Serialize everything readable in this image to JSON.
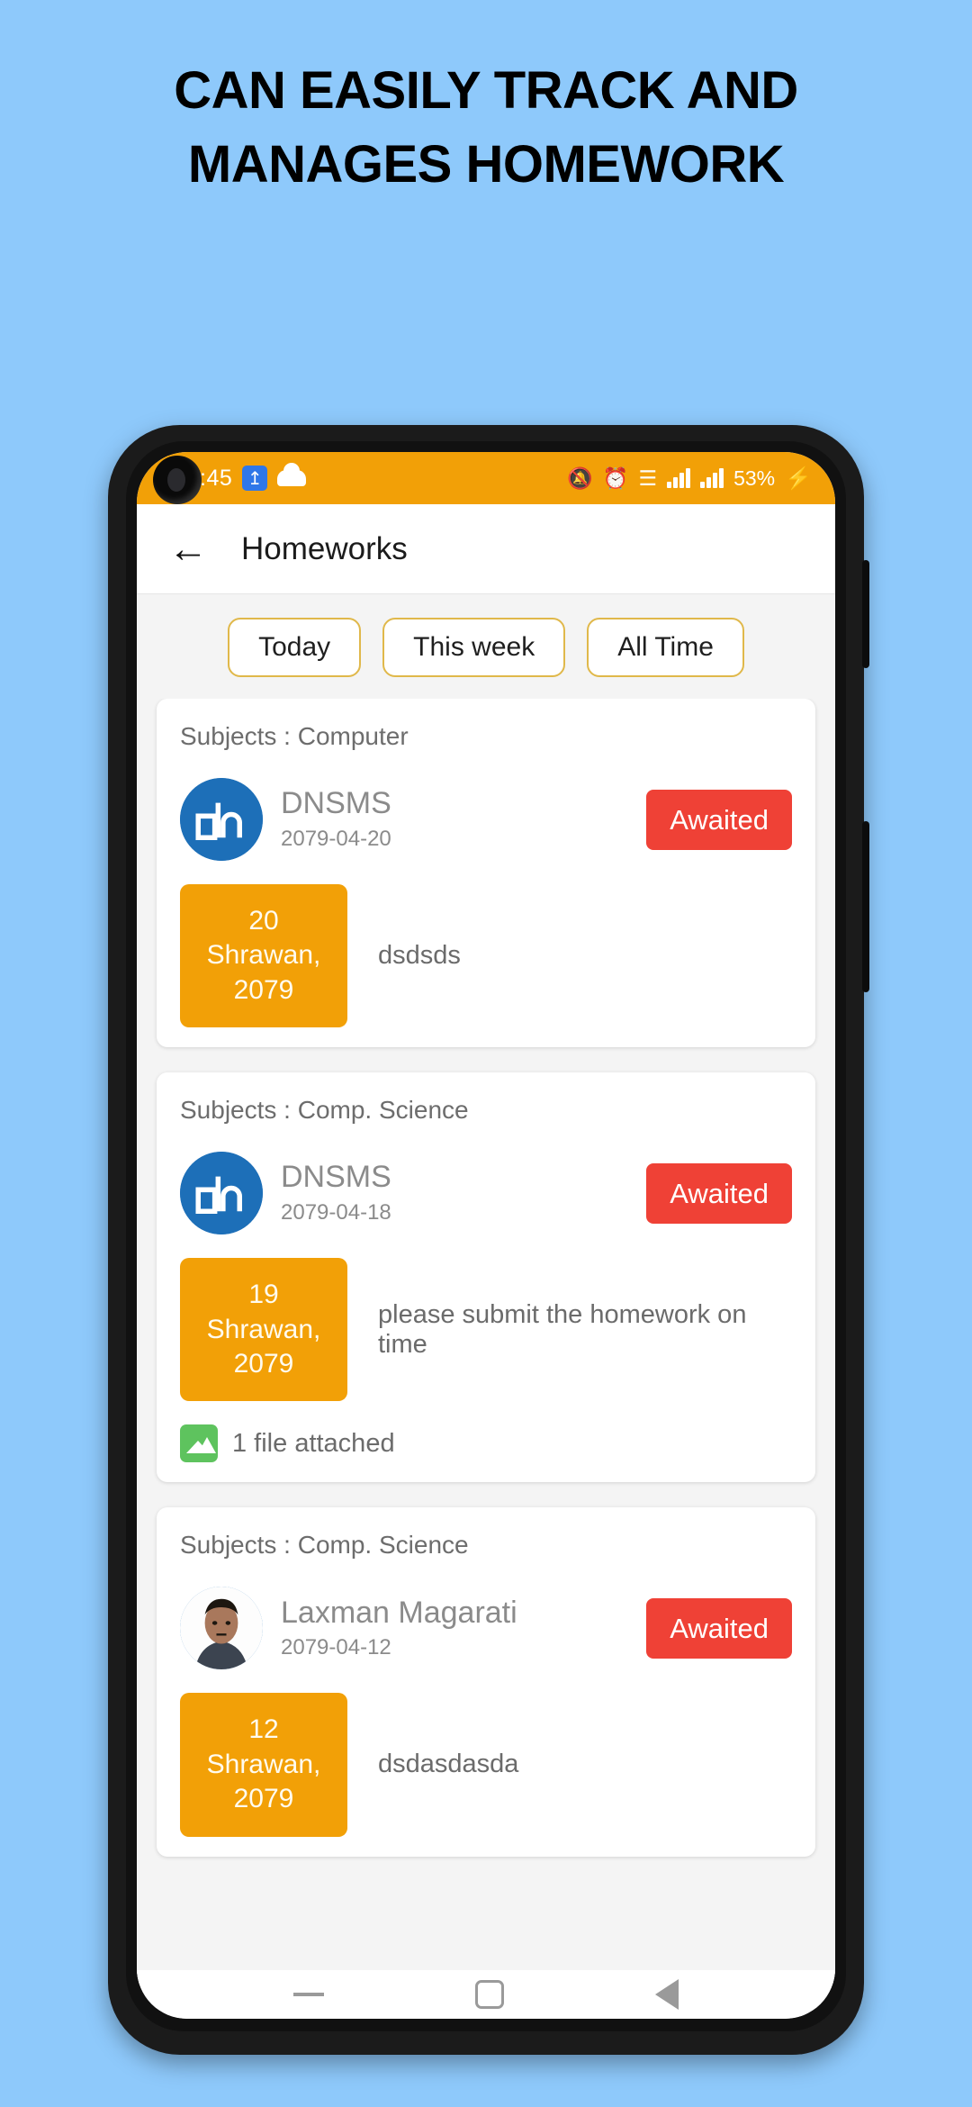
{
  "promo": {
    "line1": "CAN EASILY TRACK AND",
    "line2": "MANAGES HOMEWORK",
    "background_color": "#8ec9fb"
  },
  "status_bar": {
    "time": ":45",
    "usb_icon": "usb-icon",
    "cloud_icon": "cloud-icon",
    "notification_muted_icon": "bell-off-icon",
    "alarm_icon": "alarm-icon",
    "wifi_icon": "wifi-icon",
    "signal_icon_1": "signal-bars-icon",
    "signal_icon_2": "signal-bars-icon",
    "battery_percent": "53%",
    "charging_icon": "bolt-icon",
    "background_color": "#f2a007"
  },
  "appbar": {
    "back_icon": "back-arrow-icon",
    "title": "Homeworks"
  },
  "filters": [
    {
      "label": "Today"
    },
    {
      "label": "This week"
    },
    {
      "label": "All Time"
    }
  ],
  "theme": {
    "accent_amber": "#f2a007",
    "badge_red": "#ef4136",
    "chip_border": "#e0b84a",
    "attach_green": "#5ec35e",
    "logo_blue": "#1d6fb8"
  },
  "cards": [
    {
      "subject": "Subjects : Computer",
      "avatar_type": "dnsms-logo",
      "name": "DNSMS",
      "date": "2079-04-20",
      "status": "Awaited",
      "tile_day": "20",
      "tile_month": "Shrawan,",
      "tile_year": "2079",
      "description": "dsdsds",
      "attachment": null
    },
    {
      "subject": "Subjects : Comp. Science",
      "avatar_type": "dnsms-logo",
      "name": "DNSMS",
      "date": "2079-04-18",
      "status": "Awaited",
      "tile_day": "19",
      "tile_month": "Shrawan,",
      "tile_year": "2079",
      "description": "please submit the homework on time",
      "attachment": "1 file attached"
    },
    {
      "subject": "Subjects : Comp. Science",
      "avatar_type": "photo",
      "name": "Laxman Magarati",
      "date": "2079-04-12",
      "status": "Awaited",
      "tile_day": "12",
      "tile_month": "Shrawan,",
      "tile_year": "2079",
      "description": "dsdasdasda",
      "attachment": null
    }
  ],
  "nav_bar": {
    "recents_icon": "recents-icon",
    "home_icon": "home-icon",
    "back_icon": "back-triangle-icon"
  }
}
